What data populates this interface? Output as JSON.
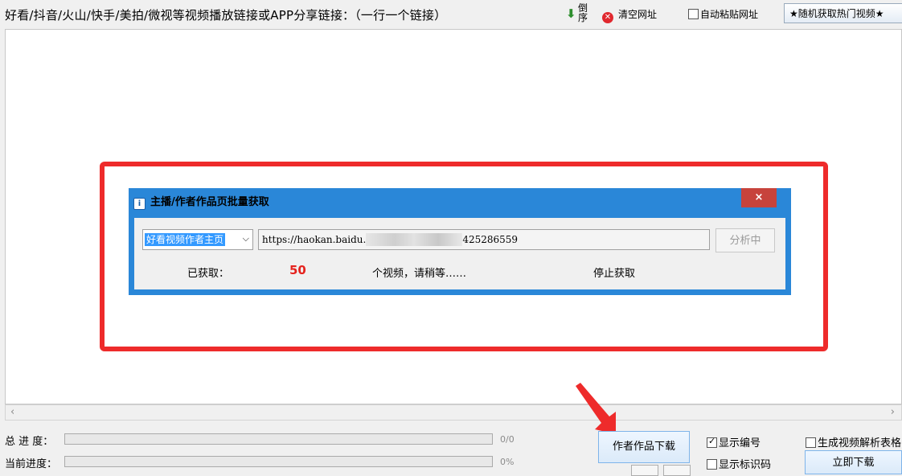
{
  "toolbar": {
    "instruction": "好看/抖音/火山/快手/美拍/微视等视频播放链接或APP分享链接：（一行一个链接）",
    "reverse_label": "倒序",
    "clear_label": "清空网址",
    "auto_paste_label": "自动粘贴网址",
    "auto_paste_checked": false,
    "random_hot_label": "★随机获取热门视频★"
  },
  "dialog": {
    "title": "主播/作者作品页批量获取",
    "close_label": "×",
    "source_select_value": "好看视频作者主页",
    "url_prefix": "https://haokan.baidu.",
    "url_suffix": "425286559",
    "analyze_label": "分析中",
    "got_label": "已获取：",
    "got_count": "50",
    "wait_message": "个视频，请稍等……",
    "stop_label": "停止获取"
  },
  "progress": {
    "total_label": "总 进 度：",
    "total_text": "0/0",
    "current_label": "当前进度：",
    "current_text": "0%"
  },
  "actions": {
    "author_download_label": "作者作品下载",
    "show_number_label": "显示编号",
    "show_number_checked": true,
    "show_code_label": "显示标识码",
    "show_code_checked": false,
    "gen_table_label": "生成视频解析表格",
    "download_now_label": "立即下载"
  },
  "colors": {
    "highlight": "#ee2b2b",
    "dialog_frame": "#2a87d8",
    "count_red": "#e5231e",
    "close_red": "#c7433c"
  }
}
